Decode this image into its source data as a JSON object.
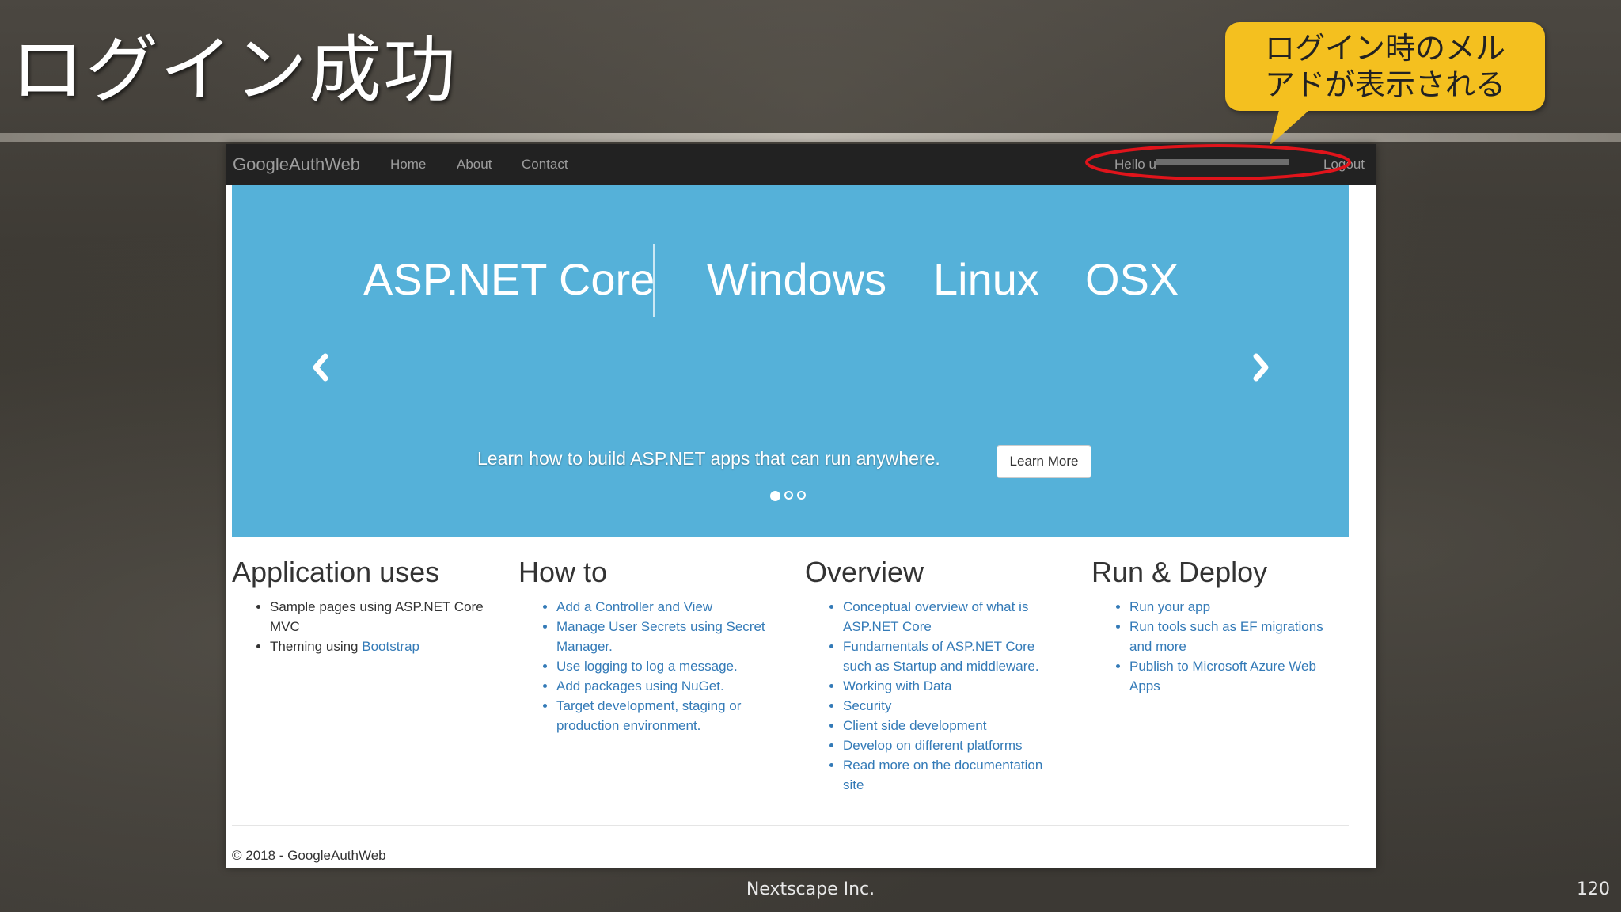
{
  "slide": {
    "title": "ログイン成功",
    "callout": "ログイン時のメルアドが表示される",
    "footer": "Nextscape Inc.",
    "page": "120",
    "colors": {
      "callout": "#f4c01f",
      "highlight_ellipse": "#e0141b"
    }
  },
  "navbar": {
    "brand": "GoogleAuthWeb",
    "links": [
      "Home",
      "About",
      "Contact"
    ],
    "hello": "Hello u",
    "logout": "Logout"
  },
  "carousel": {
    "banner": [
      "ASP.NET Core",
      "Windows",
      "Linux",
      "OSX"
    ],
    "caption": "Learn how to build ASP.NET apps that can run anywhere.",
    "button": "Learn More",
    "prev_icon": "chevron-left-icon",
    "next_icon": "chevron-right-icon",
    "indicator_count": 3,
    "active_indicator": 1,
    "background": "#55b1d9"
  },
  "sections": [
    {
      "heading": "Application uses",
      "items": [
        {
          "text": "Sample pages using ASP.NET Core MVC"
        },
        {
          "text": "Theming using ",
          "link": "Bootstrap"
        }
      ]
    },
    {
      "heading": "How to",
      "items": [
        {
          "link": "Add a Controller and View"
        },
        {
          "link": "Manage User Secrets using Secret Manager."
        },
        {
          "link": "Use logging to log a message."
        },
        {
          "link": "Add packages using NuGet."
        },
        {
          "link": "Target development, staging or production environment."
        }
      ]
    },
    {
      "heading": "Overview",
      "items": [
        {
          "link": "Conceptual overview of what is ASP.NET Core"
        },
        {
          "link": "Fundamentals of ASP.NET Core such as Startup and middleware."
        },
        {
          "link": "Working with Data"
        },
        {
          "link": "Security"
        },
        {
          "link": "Client side development"
        },
        {
          "link": "Develop on different platforms"
        },
        {
          "link": "Read more on the documentation site"
        }
      ]
    },
    {
      "heading": "Run & Deploy",
      "items": [
        {
          "link": "Run your app"
        },
        {
          "link": "Run tools such as EF migrations and more"
        },
        {
          "link": "Publish to Microsoft Azure Web Apps"
        }
      ]
    }
  ],
  "footer": "© 2018 - GoogleAuthWeb"
}
